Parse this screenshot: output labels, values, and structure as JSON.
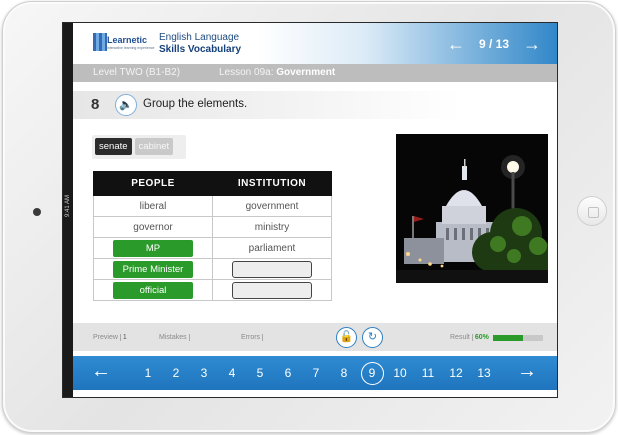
{
  "device": {
    "status_time": "9:41 AM"
  },
  "header": {
    "logo_name": "Learnetic",
    "logo_tagline": "interactive learning experience",
    "course_line1": "English Language",
    "course_line2": "Skills Vocabulary",
    "page_indicator": "9 / 13",
    "prev_icon": "arrow-left-icon",
    "next_icon": "arrow-right-icon"
  },
  "subbar": {
    "level": "Level TWO (B1-B2)",
    "lesson_prefix": "Lesson 09a:",
    "lesson_title": "Government"
  },
  "question": {
    "number": "8",
    "speaker_icon": "speaker-icon",
    "instruction": "Group the elements."
  },
  "chips": [
    "senate",
    "cabinet"
  ],
  "table": {
    "headers": [
      "PEOPLE",
      "INSTITUTION"
    ],
    "rows": [
      {
        "people": "liberal",
        "institution": "government"
      },
      {
        "people": "governor",
        "institution": "ministry"
      },
      {
        "people": "MP",
        "institution": "parliament"
      },
      {
        "people": "Prime Minister",
        "institution": ""
      },
      {
        "people": "official",
        "institution": ""
      }
    ]
  },
  "footer": {
    "preview_label": "Preview",
    "preview_value": "1",
    "mistakes_label": "Mistakes",
    "errors_label": "Errors",
    "result_label": "Result",
    "result_value": "60%",
    "result_fraction": 0.6,
    "check_icon": "lock-open-icon",
    "reset_icon": "reset-icon"
  },
  "pagination": {
    "pages": [
      "1",
      "2",
      "3",
      "4",
      "5",
      "6",
      "7",
      "8",
      "9",
      "10",
      "11",
      "12",
      "13"
    ],
    "current": "9"
  },
  "colors": {
    "accent_blue": "#2f86c8",
    "correct_green": "#2a9b2a"
  }
}
